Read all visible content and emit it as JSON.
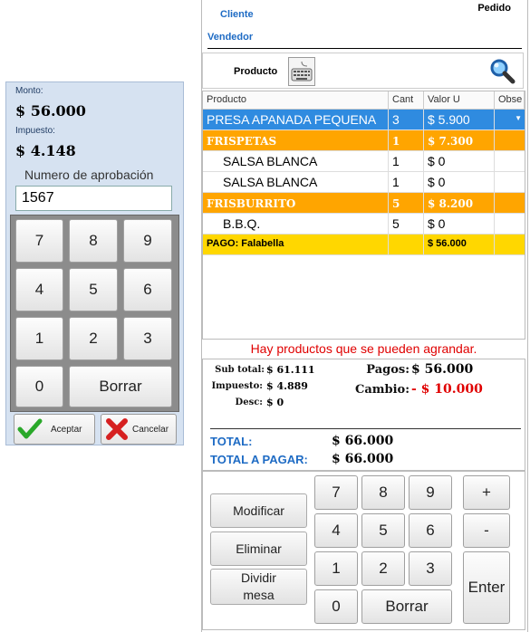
{
  "payment": {
    "monto_label": "Monto:",
    "monto_value": "$ 56.000",
    "impuesto_label": "Impuesto:",
    "impuesto_value": "$ 4.148",
    "approval_label": "Numero de aprobación",
    "approval_value": "1567",
    "keys": [
      "7",
      "8",
      "9",
      "4",
      "5",
      "6",
      "1",
      "2",
      "3",
      "0"
    ],
    "delete_label": "Borrar",
    "accept_label": "Aceptar",
    "cancel_label": "Cancelar"
  },
  "header": {
    "cliente": "Cliente",
    "vendedor": "Vendedor",
    "pedido": "Pedido",
    "producto_label": "Producto"
  },
  "grid": {
    "columns": [
      "Producto",
      "Cant",
      "Valor U",
      "Obse"
    ],
    "rows": [
      {
        "producto": "PRESA APANADA PEQUENA",
        "cant": "3",
        "valor": "$ 5.900",
        "obse": ""
      },
      {
        "producto": "FRISPETAS",
        "cant": "1",
        "valor": "$ 7.300",
        "obse": ""
      },
      {
        "producto": "SALSA BLANCA",
        "cant": "1",
        "valor": "$ 0",
        "obse": ""
      },
      {
        "producto": "SALSA BLANCA",
        "cant": "1",
        "valor": "$ 0",
        "obse": ""
      },
      {
        "producto": "FRISBURRITO",
        "cant": "5",
        "valor": "$ 8.200",
        "obse": ""
      },
      {
        "producto": "B.B.Q.",
        "cant": "5",
        "valor": "$ 0",
        "obse": ""
      },
      {
        "producto": "PAGO: Falabella",
        "cant": "",
        "valor": "$ 56.000",
        "obse": ""
      }
    ]
  },
  "warning": "Hay productos que se pueden agrandar.",
  "totals": {
    "subtotal_label": "Sub total:",
    "subtotal_value": "$ 61.111",
    "impuesto_label": "Impuesto:",
    "impuesto_value": "$ 4.889",
    "desc_label": "Desc:",
    "desc_value": "$ 0",
    "pagos_label": "Pagos:",
    "pagos_value": "$ 56.000",
    "cambio_label": "Cambio:",
    "cambio_value": "- $ 10.000",
    "total_label": "TOTAL:",
    "total_value": "$ 66.000",
    "total_pagar_label": "TOTAL A PAGAR:",
    "total_pagar_value": "$ 66.000"
  },
  "pad": {
    "modificar": "Modificar",
    "eliminar": "Eliminar",
    "dividir": "Dividir mesa",
    "keys": [
      "7",
      "8",
      "9",
      "4",
      "5",
      "6",
      "1",
      "2",
      "3",
      "0"
    ],
    "borrar": "Borrar",
    "plus": "+",
    "minus": "-",
    "enter": "Enter"
  },
  "colors": {
    "selected_row": "#2f8be0",
    "orange_row": "#ffa500",
    "yellow_row": "#ffd700",
    "accent_blue": "#1e6bc4",
    "warning_red": "#e00000"
  }
}
